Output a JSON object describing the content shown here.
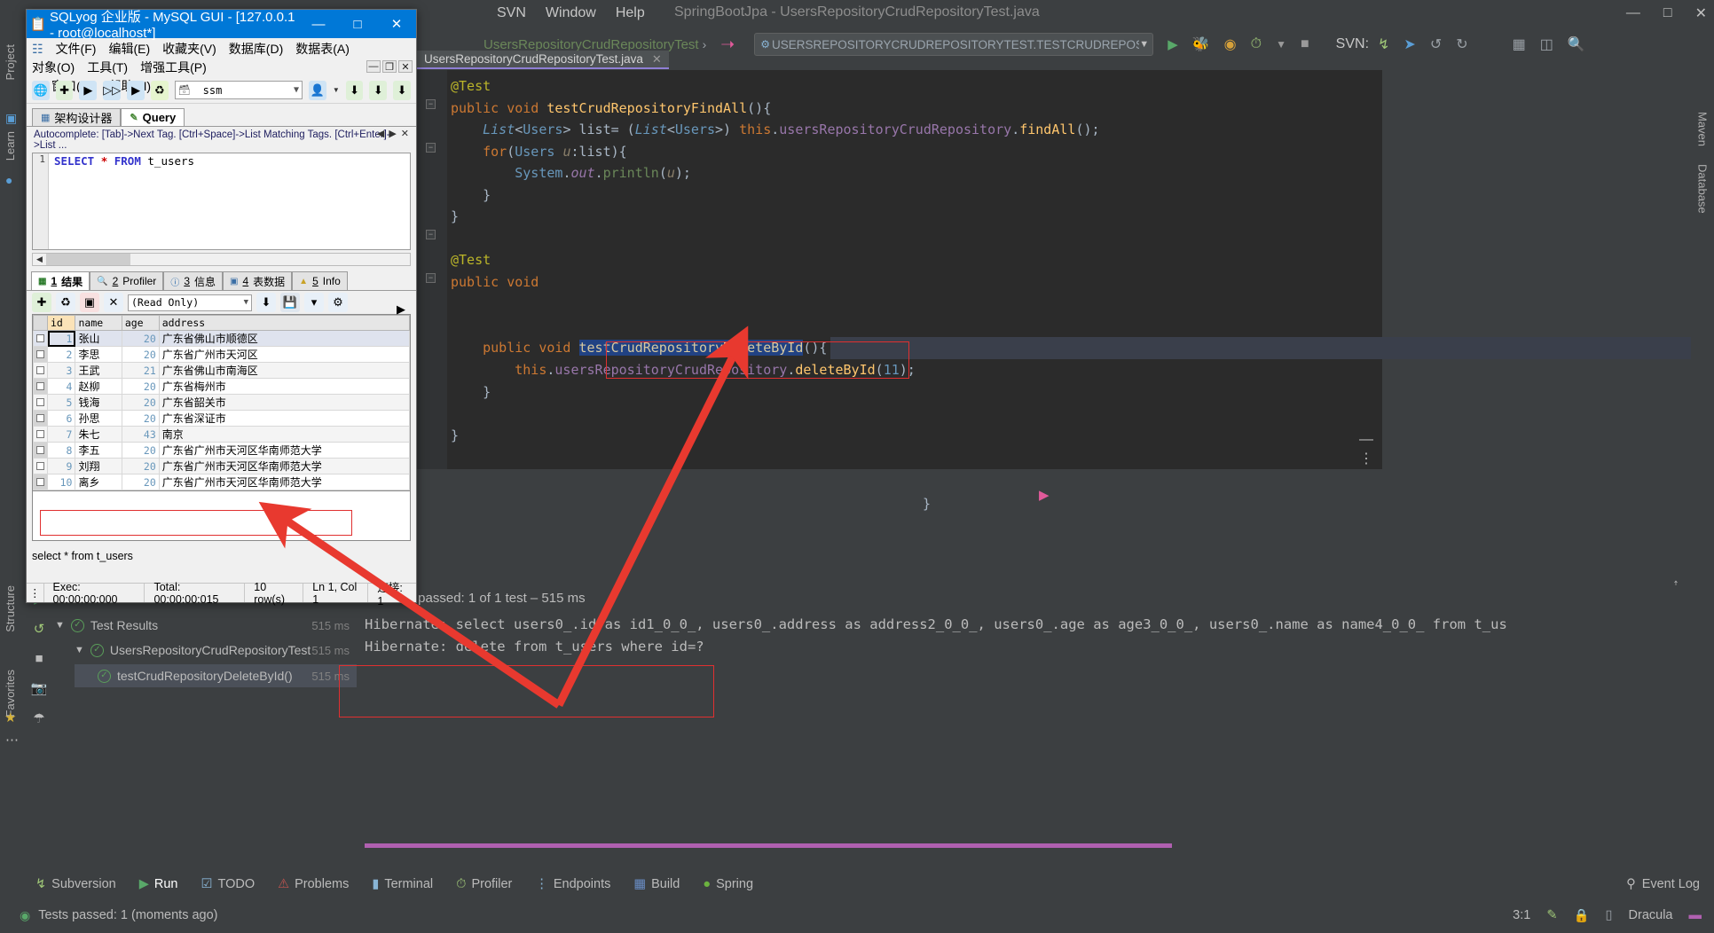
{
  "ide": {
    "menu": [
      "SVN",
      "Window",
      "Help"
    ],
    "title": "SpringBootJpa - UsersRepositoryCrudRepositoryTest.java",
    "window_buttons": [
      "minimize",
      "maximize",
      "close"
    ],
    "breadcrumb": [
      "UsersRepositoryCrudRepositoryTest",
      "›"
    ],
    "run_config": "USERSREPOSITORYCRUDREPOSITORYTEST.TESTCRUDREPOSITORYDELETEBYID",
    "svn_label": "SVN:",
    "editor_tab": "UsersRepositoryCrudRepositoryTest.java",
    "right_tool_tabs": [
      "Maven",
      "Database"
    ],
    "left_tool_tabs": [
      "Project",
      "Learn",
      "Structure",
      "Favorites"
    ],
    "code_lines": [
      "@Test",
      "public void testCrudRepositoryFindAll(){",
      "    List<Users> list= (List<Users>) this.usersRepositoryCrudRepository.findAll();",
      "    for(Users u:list){",
      "        System.out.println(u);",
      "    }",
      "}",
      "",
      "@Test",
      "public void testCrudRepositoryDeleteById(){",
      "    this.usersRepositoryCrudRepository.deleteById(11);",
      "}",
      "",
      "}"
    ],
    "selected_method": "testCrudRepositoryDeleteById"
  },
  "run_panel": {
    "title": "Test Results",
    "title_duration": "515 ms",
    "header_status": "Tests passed: 1 of 1 test – 515 ms",
    "tree": [
      {
        "label": "Test Results",
        "duration": "515 ms",
        "level": 0,
        "selected": false
      },
      {
        "label": "UsersRepositoryCrudRepositoryTest",
        "duration": "515 ms",
        "level": 1,
        "selected": false
      },
      {
        "label": "testCrudRepositoryDeleteById()",
        "duration": "515 ms",
        "level": 2,
        "selected": true
      }
    ],
    "console": [
      "Hibernate: select users0_.id as id1_0_0_, users0_.address as address2_0_0_, users0_.age as age3_0_0_, users0_.name as name4_0_0_ from t_us",
      "Hibernate: delete from t_users where id=?"
    ]
  },
  "bottom_tabs": [
    {
      "label": "Subversion",
      "icon": "branch-icon",
      "active": false
    },
    {
      "label": "Run",
      "icon": "play-icon",
      "active": true
    },
    {
      "label": "TODO",
      "icon": "checklist-icon",
      "active": false
    },
    {
      "label": "Problems",
      "icon": "error-icon",
      "active": false
    },
    {
      "label": "Terminal",
      "icon": "terminal-icon",
      "active": false
    },
    {
      "label": "Profiler",
      "icon": "profiler-icon",
      "active": false
    },
    {
      "label": "Endpoints",
      "icon": "endpoints-icon",
      "active": false
    },
    {
      "label": "Build",
      "icon": "build-icon",
      "active": false
    },
    {
      "label": "Spring",
      "icon": "spring-icon",
      "active": false
    }
  ],
  "event_log": "Event Log",
  "status_bar": {
    "message": "Tests passed: 1 (moments ago)",
    "caret_position": "3:1",
    "theme": "Dracula"
  },
  "sqlyog": {
    "title": "SQLyog 企业版 - MySQL GUI - [127.0.0.1 - root@localhost*]",
    "menu": [
      "文件(F)",
      "编辑(E)",
      "收藏夹(V)",
      "数据库(D)",
      "数据表(A)",
      "对象(O)",
      "工具(T)",
      "增强工具(P)",
      "窗口(W)",
      "帮助(H)"
    ],
    "db_combo_value": "ssm",
    "tabs": [
      {
        "label": "架构设计器",
        "active": false
      },
      {
        "label": "Query",
        "active": true
      }
    ],
    "autocomplete_hint": "Autocomplete: [Tab]->Next Tag. [Ctrl+Space]->List Matching Tags. [Ctrl+Enter]->List ...",
    "sql_line_number": "1",
    "sql_keyword1": "SELECT",
    "sql_star": "*",
    "sql_keyword2": "FROM",
    "sql_table": "t_users",
    "result_tabs": [
      {
        "num": "1",
        "label": "结果",
        "active": true
      },
      {
        "num": "2",
        "label": "Profiler",
        "active": false
      },
      {
        "num": "3",
        "label": "信息",
        "active": false
      },
      {
        "num": "4",
        "label": "表数据",
        "active": false
      },
      {
        "num": "5",
        "label": "Info",
        "active": false
      }
    ],
    "readonly_combo": "(Read Only)",
    "grid": {
      "columns": [
        "id",
        "name",
        "age",
        "address"
      ],
      "rows": [
        [
          "1",
          "张山",
          "20",
          "广东省佛山市顺德区"
        ],
        [
          "2",
          "李思",
          "20",
          "广东省广州市天河区"
        ],
        [
          "3",
          "王武",
          "21",
          "广东省佛山市南海区"
        ],
        [
          "4",
          "赵柳",
          "20",
          "广东省梅州市"
        ],
        [
          "5",
          "钱海",
          "20",
          "广东省韶关市"
        ],
        [
          "6",
          "孙思",
          "20",
          "广东省深证市"
        ],
        [
          "7",
          "朱七",
          "43",
          "南京"
        ],
        [
          "8",
          "李五",
          "20",
          "广东省广州市天河区华南师范大学"
        ],
        [
          "9",
          "刘翔",
          "20",
          "广东省广州市天河区华南师范大学"
        ],
        [
          "10",
          "离乡",
          "20",
          "广东省广州市天河区华南师范大学"
        ]
      ]
    },
    "query_line": "select  *  from  t_users",
    "status": [
      "Exec: 00:00:00:000",
      "Total: 00:00:00:015",
      "10 row(s)",
      "Ln 1, Col 1",
      "连接: 1"
    ]
  },
  "colors": {
    "accent_red": "#e03030",
    "idea_bg": "#3c3f41",
    "editor_bg": "#2b2b2b",
    "title_blue": "#0078d7",
    "tab_underline": "#8f7fd4"
  }
}
